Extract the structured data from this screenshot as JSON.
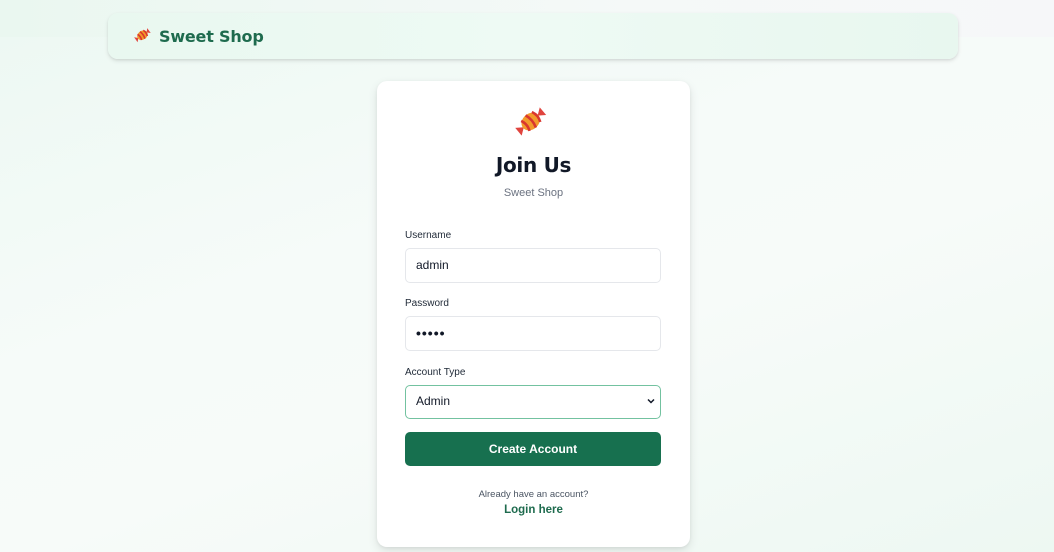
{
  "nav": {
    "brand_icon": "candy-icon",
    "brand_name": "Sweet Shop"
  },
  "card": {
    "logo_icon": "candy-icon",
    "title": "Join Us",
    "subtitle": "Sweet Shop"
  },
  "form": {
    "username": {
      "label": "Username",
      "value": "admin"
    },
    "password": {
      "label": "Password",
      "masked_value": "•••••"
    },
    "account_type": {
      "label": "Account Type",
      "selected": "Admin"
    },
    "submit_label": "Create Account"
  },
  "footer": {
    "prompt": "Already have an account?",
    "login_link": "Login here"
  },
  "colors": {
    "brand_green": "#1e6b4e",
    "button_green": "#17704f",
    "focus_border": "#73c2a0"
  }
}
